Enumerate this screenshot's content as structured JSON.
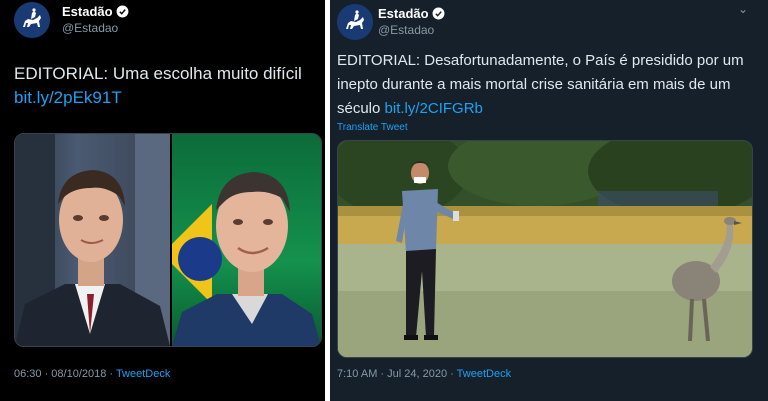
{
  "left_tweet": {
    "account": {
      "name": "Estadão",
      "handle": "@Estadao"
    },
    "text": "EDITORIAL: Uma escolha muito difícil",
    "link": "bit.ly/2pEk91T",
    "timestamp": "06:30 · 08/10/2018 · ",
    "source": "TweetDeck",
    "icons": [
      "horse-rider-logo-icon",
      "verified-icon"
    ]
  },
  "right_tweet": {
    "account": {
      "name": "Estadão",
      "handle": "@Estadao"
    },
    "text": "EDITORIAL: Desafortunadamente, o País é presidido por um inepto durante a mais mortal crise sanitária em mais de um século ",
    "link": "bit.ly/2CIFGRb",
    "translate": "Translate Tweet",
    "timestamp": "7:10 AM · Jul 24, 2020 · ",
    "source": "TweetDeck",
    "chevron": "⌄",
    "icons": [
      "horse-rider-logo-icon",
      "verified-icon",
      "chevron-down-icon"
    ]
  },
  "colors": {
    "link": "#1da1f2",
    "muted": "#8899a6",
    "left_bg": "#000000",
    "right_bg": "#15202b"
  }
}
